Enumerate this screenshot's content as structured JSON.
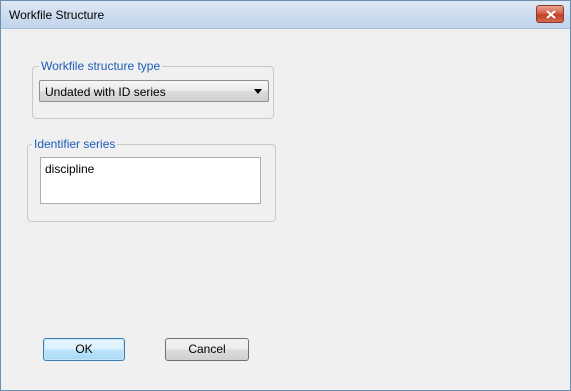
{
  "window": {
    "title": "Workfile Structure"
  },
  "structure_type": {
    "group_label": "Workfile structure type",
    "selected": "Undated with ID series"
  },
  "identifier": {
    "group_label": "Identifier series",
    "items": [
      "discipline"
    ]
  },
  "buttons": {
    "ok": "OK",
    "cancel": "Cancel"
  }
}
